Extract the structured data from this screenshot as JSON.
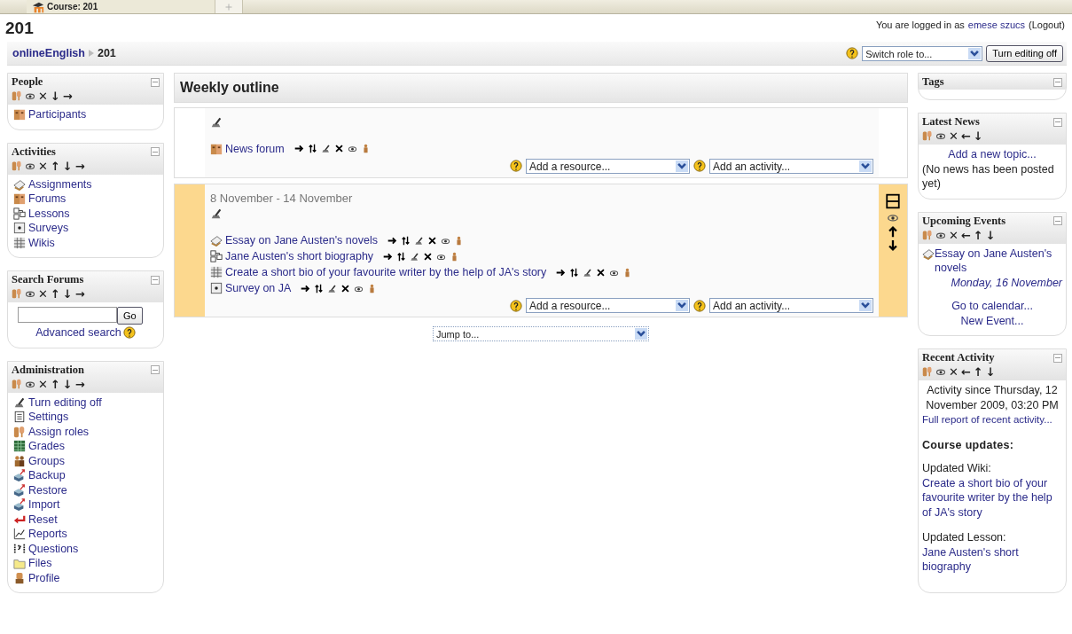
{
  "browser_tabs": [
    {
      "title": "Course: 201",
      "selected": true
    },
    {
      "selected": false
    }
  ],
  "page_title": "201",
  "login": {
    "prefix": "You are logged in as",
    "user": "emese szucs",
    "logout": "(Logout)"
  },
  "breadcrumb": [
    {
      "label": "onlineEnglish",
      "link": true
    },
    {
      "label": "201",
      "link": false
    }
  ],
  "switch_role": {
    "value": "Switch role to..."
  },
  "edit_button": "Turn editing off",
  "editing": true,
  "left_blocks": [
    {
      "kind": "list",
      "title": "People",
      "controls": [
        "✕",
        "↓",
        "→"
      ],
      "items": [
        {
          "label": "Participants",
          "kind": "people"
        }
      ]
    },
    {
      "kind": "list",
      "title": "Activities",
      "controls": [
        "✕",
        "↑",
        "↓",
        "→"
      ],
      "items": [
        {
          "label": "Assignments",
          "kind": "assignment"
        },
        {
          "label": "Forums",
          "kind": "people"
        },
        {
          "label": "Lessons",
          "kind": "lesson"
        },
        {
          "label": "Surveys",
          "kind": "survey"
        },
        {
          "label": "Wikis",
          "kind": "wiki"
        }
      ]
    },
    {
      "kind": "search",
      "title": "Search Forums",
      "controls": [
        "✕",
        "↑",
        "↓",
        "→"
      ],
      "button": "Go",
      "link": "Advanced search"
    },
    {
      "kind": "list",
      "title": "Administration",
      "controls": [
        "✕",
        "↑",
        "↓",
        "→"
      ],
      "items": [
        {
          "label": "Turn editing off",
          "kind": "edit"
        },
        {
          "label": "Settings",
          "kind": "document"
        },
        {
          "label": "Assign roles",
          "kind": "roles"
        },
        {
          "label": "Grades",
          "kind": "grades"
        },
        {
          "label": "Groups",
          "kind": "groups"
        },
        {
          "label": "Backup",
          "kind": "box"
        },
        {
          "label": "Restore",
          "kind": "box"
        },
        {
          "label": "Import",
          "kind": "box"
        },
        {
          "label": "Reset",
          "kind": "reset"
        },
        {
          "label": "Reports",
          "kind": "chart"
        },
        {
          "label": "Questions",
          "kind": "questions"
        },
        {
          "label": "Files",
          "kind": "folder"
        },
        {
          "label": "Profile",
          "kind": "person"
        }
      ]
    }
  ],
  "outline": {
    "title": "Weekly outline",
    "sections": [
      {
        "current": false,
        "activities": [
          {
            "label": "News forum",
            "kind": "people"
          }
        ],
        "resource_select": "Add a resource...",
        "activity_select": "Add an activity..."
      },
      {
        "dates": "8 November - 14 November",
        "current": true,
        "activities": [
          {
            "label": "Essay on Jane Austen's novels",
            "kind": "assignment"
          },
          {
            "label": "Jane Austen's short biography",
            "kind": "lesson"
          },
          {
            "label": "Create a short bio of your favourite writer by the help of JA's story",
            "kind": "wiki"
          },
          {
            "label": "Survey on JA",
            "kind": "survey"
          }
        ],
        "resource_select": "Add a resource...",
        "activity_select": "Add an activity..."
      }
    ],
    "jump": "Jump to..."
  },
  "right_blocks": [
    {
      "kind": "empty",
      "title": "Tags"
    },
    {
      "kind": "news",
      "title": "Latest News",
      "controls": [
        "✕",
        "←",
        "↓"
      ],
      "link": "Add a new topic...",
      "note": "(No news has been posted yet)"
    },
    {
      "kind": "events",
      "title": "Upcoming Events",
      "controls": [
        "✕",
        "←",
        "↑",
        "↓"
      ],
      "events": [
        {
          "name": "Essay on Jane Austen's novels",
          "date": "Monday, 16 November"
        }
      ],
      "links": [
        "Go to calendar...",
        "New Event..."
      ]
    },
    {
      "kind": "recent",
      "title": "Recent Activity",
      "controls": [
        "✕",
        "←",
        "↑",
        "↓"
      ],
      "since": "Activity since Thursday, 12 November 2009, 03:20 PM",
      "report": "Full report of recent activity...",
      "heading": "Course updates:",
      "updates": [
        {
          "label": "Updated Wiki:",
          "link": "Create a short bio of your favourite writer by the help of JA's story"
        },
        {
          "label": "Updated Lesson:",
          "link": "Jane Austen's short biography"
        }
      ]
    }
  ]
}
